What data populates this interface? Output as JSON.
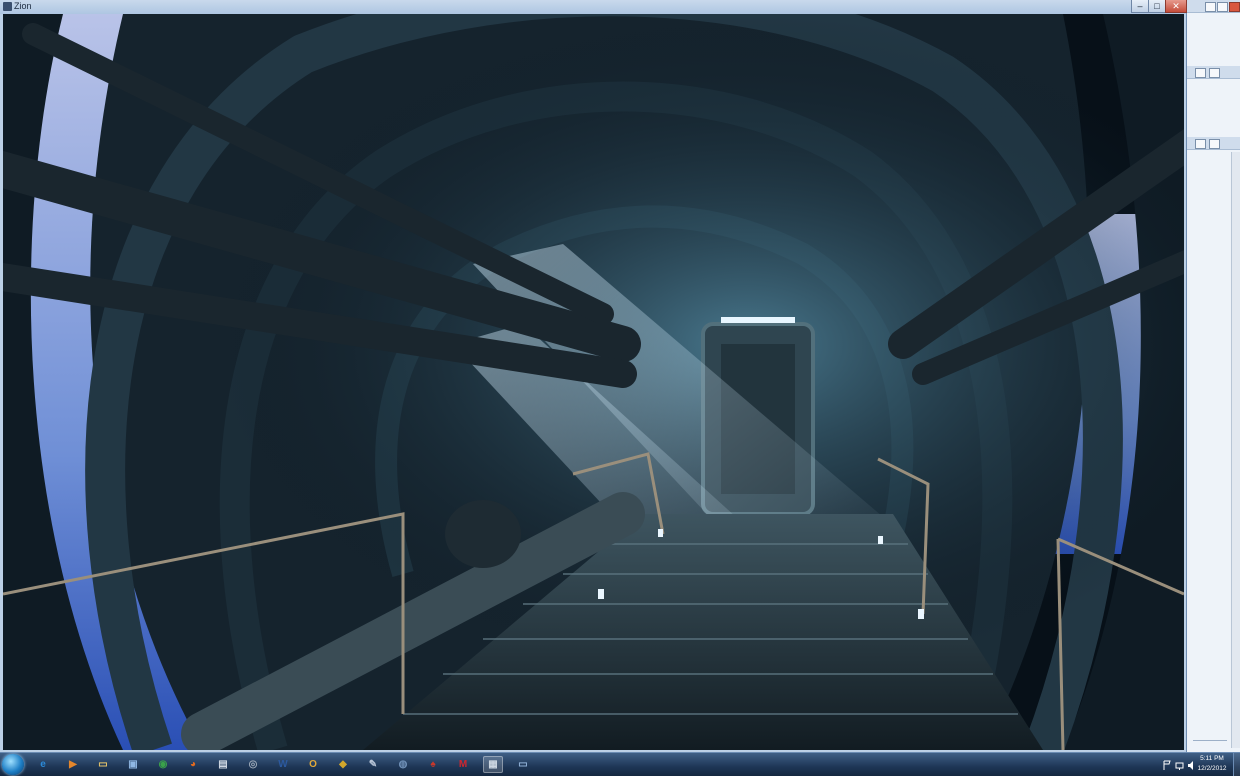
{
  "window": {
    "title": "Zion",
    "minimize": "–",
    "maximize": "□",
    "close": "✕"
  },
  "taskbar": {
    "start_icon": "windows-start-orb",
    "apps": [
      {
        "name": "internet-explorer-icon",
        "glyph": "e",
        "color": "#2b8ad8"
      },
      {
        "name": "media-player-icon",
        "glyph": "▶",
        "color": "#e3862c"
      },
      {
        "name": "file-explorer-icon",
        "glyph": "▭",
        "color": "#e5c46b"
      },
      {
        "name": "photo-viewer-icon",
        "glyph": "▣",
        "color": "#8fb7e3"
      },
      {
        "name": "chrome-icon",
        "glyph": "◉",
        "color": "#3aa14a"
      },
      {
        "name": "firefox-icon",
        "glyph": "◕",
        "color": "#e06a20"
      },
      {
        "name": "notepad-icon",
        "glyph": "▤",
        "color": "#cfd8e3"
      },
      {
        "name": "eye-app-icon",
        "glyph": "◎",
        "color": "#9aa7b6"
      },
      {
        "name": "word-icon",
        "glyph": "W",
        "color": "#2c5aa0"
      },
      {
        "name": "outlook-icon",
        "glyph": "O",
        "color": "#e0a83a"
      },
      {
        "name": "game-icon",
        "glyph": "◆",
        "color": "#d2a72c"
      },
      {
        "name": "paint-icon",
        "glyph": "✎",
        "color": "#b9c6d8"
      },
      {
        "name": "steam-icon",
        "glyph": "◍",
        "color": "#6e8fb6"
      },
      {
        "name": "devil-app-icon",
        "glyph": "♠",
        "color": "#c9382b"
      },
      {
        "name": "m-app-icon",
        "glyph": "M",
        "color": "#d0262e"
      },
      {
        "name": "zion-app-icon",
        "glyph": "▦",
        "color": "#cdd7e2"
      },
      {
        "name": "window-app-icon",
        "glyph": "▭",
        "color": "#8fb0d6"
      }
    ],
    "clock_time": "5:11 PM",
    "clock_date": "12/2/2012"
  }
}
